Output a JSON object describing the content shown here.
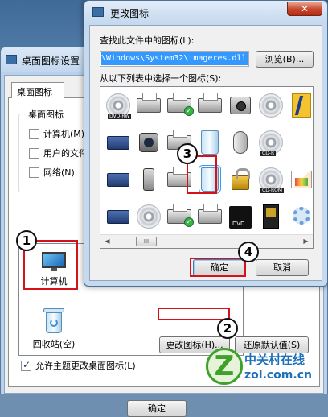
{
  "back_window": {
    "title": "桌面图标设置",
    "tab_label": "桌面图标",
    "group_label": "桌面图标",
    "checkboxes": [
      {
        "label": "计算机(M)",
        "checked": false
      },
      {
        "label": "用户的文件",
        "checked": false
      },
      {
        "label": "网络(N)",
        "checked": false
      }
    ],
    "icons": [
      {
        "label": "计算机"
      },
      {
        "label": "回收站(空)"
      }
    ],
    "change_icon_button": "更改图标(H)...",
    "restore_default_button": "还原默认值(S)",
    "allow_theme_checkbox": {
      "label": "允许主题更改桌面图标(L)",
      "checked": true
    },
    "ok_button": "确定"
  },
  "change_icon_dialog": {
    "title": "更改图标",
    "close_glyph": "✕",
    "find_label": "查找此文件中的图标(L):",
    "path_value": "\\Windows\\System32\\imageres.dll",
    "browse_button": "浏览(B)...",
    "select_label": "从以下列表中选择一个图标(S):",
    "grid_icons": [
      [
        "dvd-rw-disc",
        "printer",
        "printer-ok",
        "printer-fax",
        "camera",
        "disc",
        "folder-notes"
      ],
      [
        "scanner-box",
        "webcam",
        "printer-ok",
        "recycle-bin-full",
        "mouse",
        "cd-r-disc",
        ""
      ],
      [
        "tape-drive",
        "mobile-phone",
        "printer",
        "recycle-bin-empty",
        "padlock",
        "cd-rom-disc",
        "picture"
      ],
      [
        "drive-stack",
        "drive-disc",
        "printer-ok",
        "printer",
        "dvd-case",
        "sd-card",
        "gear"
      ]
    ],
    "disc_tags": {
      "dvd-rw-disc": "DVD-RW",
      "cd-r-disc": "CD-R",
      "cd-rom-disc": "CD-ROM",
      "disc": ""
    },
    "scroll_left": "◀",
    "scroll_right": "▶",
    "scroll_thumb": "III",
    "ok_button": "确定",
    "cancel_button": "取消"
  },
  "annotations": [
    "1",
    "2",
    "3",
    "4"
  ],
  "highlight_color": "#d5121a",
  "watermark": {
    "glyph": "Z",
    "cn": "中关村在线",
    "en": "zol.com.cn"
  }
}
